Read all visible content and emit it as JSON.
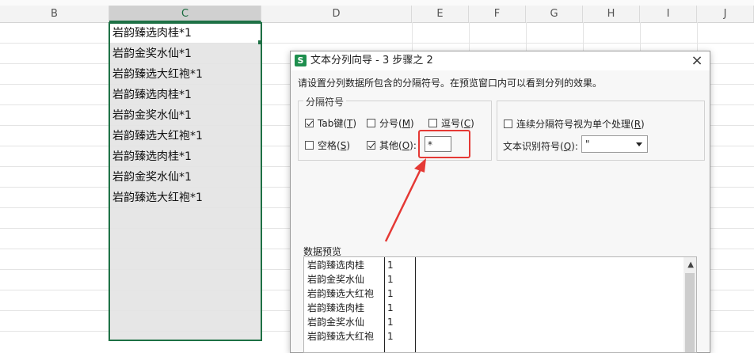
{
  "sheet": {
    "columns": [
      "B",
      "C",
      "D",
      "E",
      "F",
      "G",
      "H",
      "I",
      "J"
    ],
    "cells": [
      "岩韵臻选肉桂*1",
      "岩韵金奖水仙*1",
      "岩韵臻选大红袍*1",
      "岩韵臻选肉桂*1",
      "岩韵金奖水仙*1",
      "岩韵臻选大红袍*1",
      "岩韵臻选肉桂*1",
      "岩韵金奖水仙*1",
      "岩韵臻选大红袍*1"
    ]
  },
  "dialog": {
    "app_icon": "S",
    "title": "文本分列向导 - 3 步骤之 2",
    "close": "×",
    "intro": "请设置分列数据所包含的分隔符号。在预览窗口内可以看到分列的效果。",
    "delimiters_group": "分隔符号",
    "tab": {
      "label": "Tab键(",
      "key": "T",
      "end": ")",
      "checked": true
    },
    "semicolon": {
      "label": "分号(",
      "key": "M",
      "end": ")",
      "checked": false
    },
    "comma": {
      "label": "逗号(",
      "key": "C",
      "end": ")",
      "checked": false
    },
    "space": {
      "label": "空格(",
      "key": "S",
      "end": ")",
      "checked": false
    },
    "other": {
      "label": "其他(",
      "key": "O",
      "end": "):",
      "checked": true,
      "value": "*"
    },
    "consecutive": {
      "label": "连续分隔符号视为单个处理(",
      "key": "R",
      "end": ")",
      "checked": false
    },
    "qualifier": {
      "label": "文本识别符号(",
      "key": "Q",
      "end": "):",
      "value": "\""
    },
    "preview_label": "数据预览",
    "preview_rows": [
      [
        "岩韵臻选肉桂",
        "1"
      ],
      [
        "岩韵金奖水仙",
        "1"
      ],
      [
        "岩韵臻选大红袍",
        "1"
      ],
      [
        "岩韵臻选肉桂",
        "1"
      ],
      [
        "岩韵金奖水仙",
        "1"
      ],
      [
        "岩韵臻选大红袍",
        "1"
      ]
    ]
  },
  "colors": {
    "accent": "#1e7145",
    "annotation": "#e53935"
  }
}
